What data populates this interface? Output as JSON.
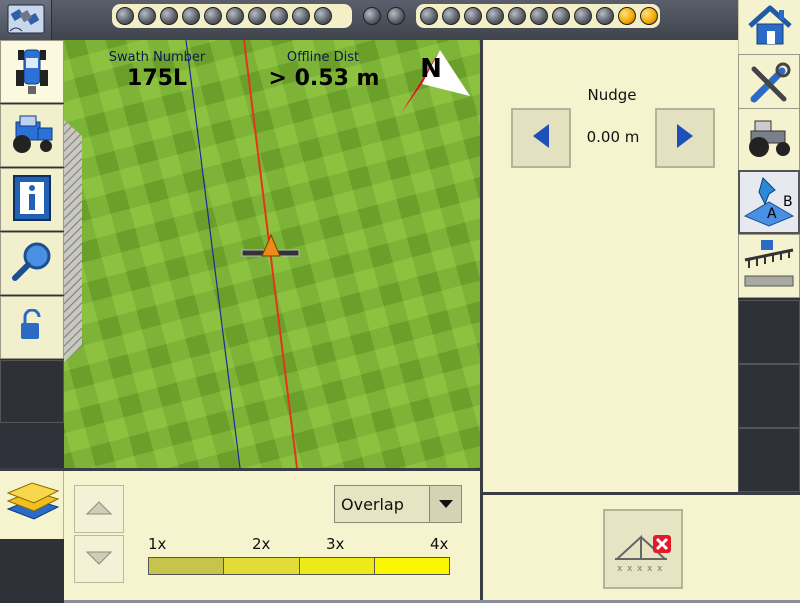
{
  "map": {
    "swath_title": "Swath Number",
    "swath_value": "175L",
    "offline_title": "Offline Dist",
    "offline_value": "> 0.53 m",
    "compass_letter": "N"
  },
  "nudge": {
    "title": "Nudge",
    "value": "0.00 m"
  },
  "coverage": {
    "dropdown_value": "Overlap",
    "legend_labels": [
      "1x",
      "2x",
      "3x",
      "4x"
    ],
    "legend_colors": [
      "#c7c44c",
      "#e1dc38",
      "#eeea1a",
      "#fbf700"
    ]
  },
  "lightbar": {
    "left_leds": [
      "off",
      "off",
      "off",
      "off",
      "off",
      "off",
      "off",
      "off",
      "off",
      "off"
    ],
    "center_leds": [
      "off",
      "off"
    ],
    "right_leds": [
      "off",
      "off",
      "off",
      "off",
      "off",
      "off",
      "off",
      "off",
      "off",
      "orange",
      "orange"
    ]
  },
  "icons": {
    "gps": "satellite-icon",
    "home": "home-icon",
    "settings": "tools-icon",
    "vehicle": "tractor-icon",
    "guidance": "ab-line-icon",
    "implement": "implement-icon",
    "layers": "layers-icon",
    "info": "info-icon",
    "search": "magnifier-icon",
    "lock": "unlock-icon"
  },
  "colors": {
    "panel_bg": "#f6f3cf",
    "guidance_line": "#e8321c",
    "swath_line": "#1b2a9a"
  }
}
